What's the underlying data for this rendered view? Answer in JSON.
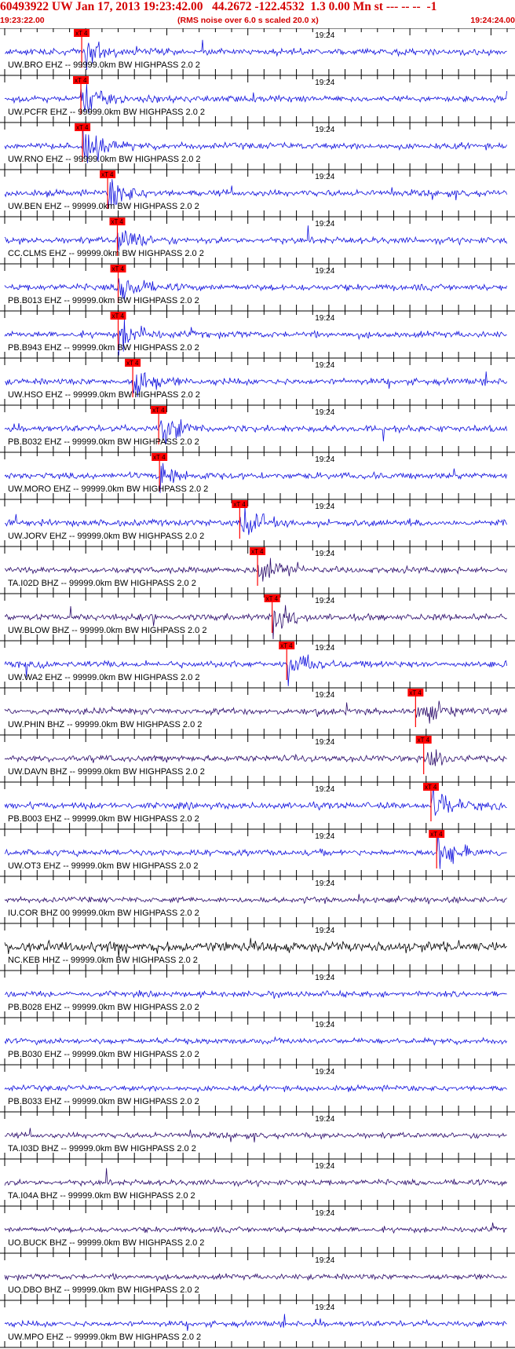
{
  "header": {
    "title": "60493922 UW Jan 17, 2013 19:23:42.00   44.2672 -122.4532  1.3 0.00 Mn st --- -- --  -1",
    "start_time": "19:23:22.00",
    "noise_note": "(RMS noise over 6.0 s scaled 20.0 x)",
    "end_time": "19:24:24.00"
  },
  "chart_data": {
    "type": "line",
    "title": "60493922 UW Jan 17, 2013 19:23:42.00   44.2672 -122.4532  1.3 0.00 Mn st --- -- --  -1",
    "x_range": [
      "19:23:22.00",
      "19:24:24.00"
    ],
    "x_range_seconds": [
      0,
      62
    ],
    "tick_interval_seconds": 2,
    "center_tick_label": "19:24",
    "center_tick_seconds": 38,
    "pick_label": "xT 4",
    "grid": true,
    "colors": {
      "primary": "#1010dd",
      "secondary": "#2a0a6a",
      "dark": "#000000",
      "pick": "#ff0000",
      "header": "#d40000"
    },
    "traces": [
      {
        "label": "UW.BRO EHZ -- 99999.0km BW  HIGHPASS  2.0  2",
        "pick_s": 9.5
      },
      {
        "label": "UW.PCFR EHZ -- 99999.0km BW  HIGHPASS  2.0  2",
        "pick_s": 9.4
      },
      {
        "label": "UW.RNO EHZ -- 99999.0km BW  HIGHPASS  2.0  2",
        "pick_s": 9.6
      },
      {
        "label": "UW.BEN EHZ -- 99999.0km BW  HIGHPASS  2.0  2",
        "pick_s": 12.7
      },
      {
        "label": "CC.CLMS EHZ -- 99999.0km BW  HIGHPASS  2.0  2",
        "pick_s": 13.9
      },
      {
        "label": "PB.B013 EHZ -- 99999.0km BW  HIGHPASS  2.0  2",
        "pick_s": 14.0
      },
      {
        "label": "PB.B943 EHZ -- 99999.0km BW  HIGHPASS  2.0  2",
        "pick_s": 14.0
      },
      {
        "label": "UW.HSO EHZ -- 99999.0km BW  HIGHPASS  2.0  2",
        "pick_s": 15.8
      },
      {
        "label": "PB.B032 EHZ -- 99999.0km BW  HIGHPASS  2.0  2",
        "pick_s": 19.0
      },
      {
        "label": "UW.MORO EHZ -- 99999.0km BW  HIGHPASS  2.0  2",
        "pick_s": 19.1
      },
      {
        "label": "UW.JORV EHZ -- 99999.0km BW  HIGHPASS  2.0  2",
        "pick_s": 29.0
      },
      {
        "label": "TA.I02D BHZ -- 99999.0km BW  HIGHPASS  2.0  2",
        "pick_s": 31.2
      },
      {
        "label": "UW.BLOW BHZ -- 99999.0km BW  HIGHPASS  2.0  2",
        "pick_s": 33.0
      },
      {
        "label": "UW.WA2 EHZ -- 99999.0km BW  HIGHPASS  2.0  2",
        "pick_s": 34.8
      },
      {
        "label": "UW.PHIN BHZ -- 99999.0km BW  HIGHPASS  2.0  2",
        "pick_s": 50.7
      },
      {
        "label": "UW.DAVN BHZ -- 99999.0km BW  HIGHPASS  2.0  2",
        "pick_s": 51.7
      },
      {
        "label": "PB.B003 EHZ -- 99999.0km BW  HIGHPASS  2.0  2",
        "pick_s": 52.6
      },
      {
        "label": "UW.OT3 EHZ -- 99999.0km BW  HIGHPASS  2.0  2",
        "pick_s": 53.3
      },
      {
        "label": "IU.COR BHZ 00 99999.0km BW  HIGHPASS  2.0  2",
        "pick_s": null
      },
      {
        "label": "NC.KEB HHZ -- 99999.0km BW  HIGHPASS  2.0  2",
        "pick_s": null
      },
      {
        "label": "PB.B028 EHZ -- 99999.0km BW  HIGHPASS  2.0  2",
        "pick_s": null
      },
      {
        "label": "PB.B030 EHZ -- 99999.0km BW  HIGHPASS  2.0  2",
        "pick_s": null
      },
      {
        "label": "PB.B033 EHZ -- 99999.0km BW  HIGHPASS  2.0  2",
        "pick_s": null
      },
      {
        "label": "TA.I03D BHZ -- 99999.0km BW  HIGHPASS  2.0  2",
        "pick_s": null
      },
      {
        "label": "TA.I04A BHZ -- 99999.0km BW  HIGHPASS  2.0  2",
        "pick_s": null
      },
      {
        "label": "UO.BUCK BHZ -- 99999.0km BW  HIGHPASS  2.0  2",
        "pick_s": null
      },
      {
        "label": "UO.DBO BHZ -- 99999.0km BW  HIGHPASS  2.0  2",
        "pick_s": null
      },
      {
        "label": "UW.MPO EHZ -- 99999.0km BW  HIGHPASS  2.0  2",
        "pick_s": null
      }
    ]
  }
}
